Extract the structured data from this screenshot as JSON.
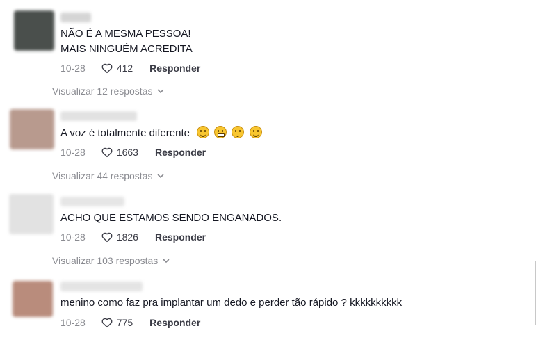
{
  "comments": [
    {
      "text_lines": [
        "NÃO É A MESMA PESSOA!",
        "MAIS NINGUÉM ACREDITA"
      ],
      "date": "10-28",
      "likes": "412",
      "reply_label": "Responder",
      "view_replies": "Visualizar 12 respostas",
      "avatar_color": "#4a4f4c",
      "username_color": "#d5d5d5"
    },
    {
      "text_lines": [
        "A voz é totalmente diferente"
      ],
      "emoji_icons": [
        "smirk-face-icon",
        "grimacing-face-icon",
        "flushed-face-icon",
        "grinning-sweat-face-icon"
      ],
      "date": "10-28",
      "likes": "1663",
      "reply_label": "Responder",
      "view_replies": "Visualizar 44 respostas",
      "avatar_color": "#b89a8e",
      "username_color": "#e2e2e2"
    },
    {
      "text_lines": [
        "ACHO QUE ESTAMOS SENDO ENGANADOS."
      ],
      "date": "10-28",
      "likes": "1826",
      "reply_label": "Responder",
      "view_replies": "Visualizar 103 respostas",
      "avatar_color": "#e2e2e2",
      "username_color": "#e6e6e6"
    },
    {
      "text_lines": [
        "menino como faz pra implantar um dedo e perder tão rápido ? kkkkkkkkkk"
      ],
      "date": "10-28",
      "likes": "775",
      "reply_label": "Responder",
      "avatar_color": "#b98c7c",
      "username_color": "#e4e4e4"
    }
  ],
  "icons": {
    "like": "heart-outline-icon",
    "expand": "chevron-down-icon"
  },
  "colors": {
    "text": "#161823",
    "muted": "#8a8b91",
    "action": "#3a3b45"
  }
}
